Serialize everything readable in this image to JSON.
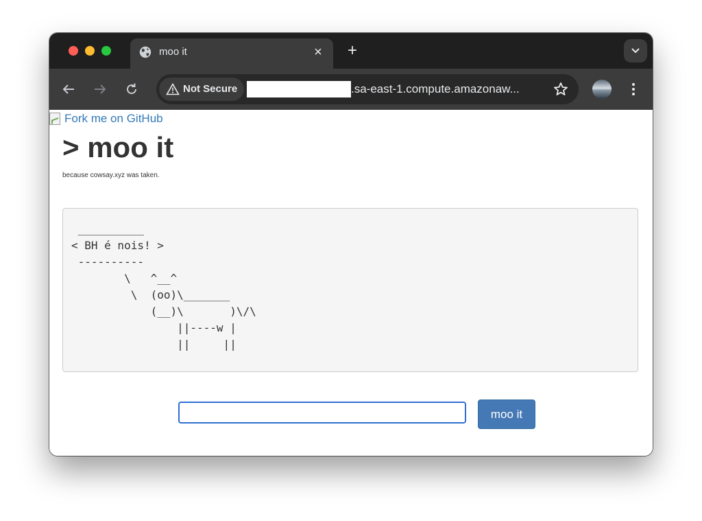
{
  "browser": {
    "tab": {
      "title": "moo it",
      "close_glyph": "×",
      "icon": "globe-icon"
    },
    "new_tab_glyph": "+",
    "security_label": "Not Secure",
    "url_visible": ".sa-east-1.compute.amazonaw...",
    "icons": [
      "back-arrow-icon",
      "forward-arrow-icon",
      "reload-icon",
      "warning-triangle-icon",
      "star-icon",
      "profile-avatar",
      "more-menu-icon",
      "tab-search-chevron-icon"
    ]
  },
  "page": {
    "fork_link": "Fork me on GitHub",
    "title": "> moo it",
    "subtitle": "because cowsay.xyz was taken.",
    "cow_output": " __________\n< BH é nois! >\n ----------\n        \\   ^__^\n         \\  (oo)\\_______\n            (__)\\       )\\/\\\n                ||----w |\n                ||     ||",
    "input": {
      "value": "",
      "placeholder": ""
    },
    "submit_label": "moo it"
  },
  "colors": {
    "link": "#337ab7",
    "button": "#4579b5",
    "input_focus_border": "#2f6fd1",
    "pre_background": "#f5f5f5"
  }
}
